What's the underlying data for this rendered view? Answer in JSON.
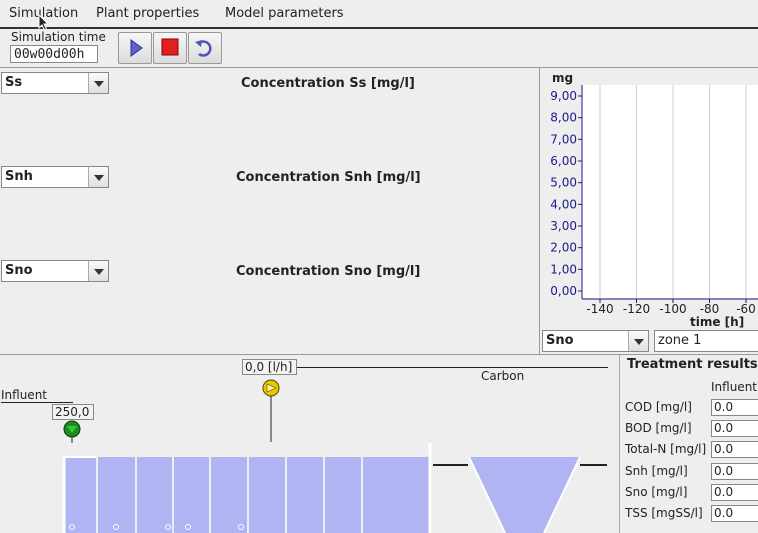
{
  "menu": {
    "items": [
      "Simulation",
      "Plant properties",
      "Model parameters"
    ]
  },
  "toolbar": {
    "sim_time_label": "Simulation time",
    "sim_time_value": "00w00d00h"
  },
  "concentrations": [
    {
      "select_value": "Ss",
      "title": "Concentration Ss [mg/l]"
    },
    {
      "select_value": "Snh",
      "title": "Concentration Snh [mg/l]"
    },
    {
      "select_value": "Sno",
      "title": "Concentration Sno [mg/l]"
    }
  ],
  "chart_data": {
    "type": "line",
    "ylabel": "mg",
    "xlabel": "time [h]",
    "ylim": [
      0,
      9
    ],
    "yticks": [
      "9,00",
      "8,00",
      "7,00",
      "6,00",
      "5,00",
      "4,00",
      "3,00",
      "2,00",
      "1,00",
      "0,00"
    ],
    "xticks": [
      "-140",
      "-120",
      "-100",
      "-80",
      "-60"
    ],
    "grid": true,
    "series": []
  },
  "chart_controls": {
    "variable": "Sno",
    "zone": "zone 1"
  },
  "plant": {
    "influent_label": "Influent",
    "influent_flow": "250,0",
    "carbon_flow": "0,0 [l/h]",
    "carbon_label": "Carbon",
    "tank_color": "#b0b4f2"
  },
  "results": {
    "title": "Treatment results",
    "column": "Influent",
    "rows": [
      {
        "label": "COD [mg/l]",
        "value": "0.0"
      },
      {
        "label": "BOD [mg/l]",
        "value": "0.0"
      },
      {
        "label": "Total-N [mg/l]",
        "value": "0.0"
      },
      {
        "label": "Snh [mg/l]",
        "value": "0.0"
      },
      {
        "label": "Sno [mg/l]",
        "value": "0.0"
      },
      {
        "label": "TSS [mgSS/l]",
        "value": "0.0"
      }
    ]
  }
}
